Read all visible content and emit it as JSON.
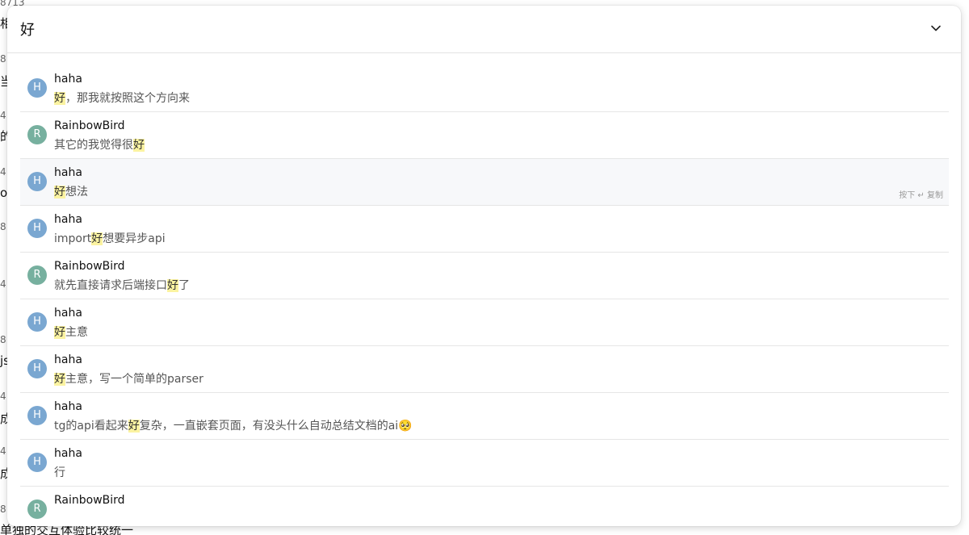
{
  "background": {
    "lines": [
      {
        "kind": "meta",
        "text": "8713"
      },
      {
        "kind": "text",
        "text": "相"
      },
      {
        "kind": "meta",
        "text": "8"
      },
      {
        "kind": "text",
        "text": "当"
      },
      {
        "kind": "meta",
        "text": "4"
      },
      {
        "kind": "text",
        "text": "的"
      },
      {
        "kind": "meta",
        "text": "4"
      },
      {
        "kind": "text",
        "text": "or"
      },
      {
        "kind": "meta",
        "text": "8"
      },
      {
        "kind": "meta",
        "text": "4"
      },
      {
        "kind": "meta",
        "text": "8"
      },
      {
        "kind": "text",
        "text": "js"
      },
      {
        "kind": "meta",
        "text": "4"
      },
      {
        "kind": "text",
        "text": "成"
      },
      {
        "kind": "meta",
        "text": "4"
      },
      {
        "kind": "text",
        "text": "成"
      },
      {
        "kind": "meta",
        "text": "8"
      },
      {
        "kind": "text",
        "text": "单独的交互体验比较统一"
      }
    ]
  },
  "search": {
    "query": "好",
    "collapse_icon": "chevron-down-icon"
  },
  "results": [
    {
      "avatar": "H",
      "avatar_color": "#7aa7d1",
      "sender": "haha",
      "before": "",
      "match": "好",
      "after": "，那我就按照这个方向来",
      "selected": false
    },
    {
      "avatar": "R",
      "avatar_color": "#77b09f",
      "sender": "RainbowBird",
      "before": "其它的我觉得很",
      "match": "好",
      "after": "",
      "selected": false
    },
    {
      "avatar": "H",
      "avatar_color": "#7aa7d1",
      "sender": "haha",
      "before": "",
      "match": "好",
      "after": "想法",
      "selected": true,
      "hint": "按下 ↵ 复制"
    },
    {
      "avatar": "H",
      "avatar_color": "#7aa7d1",
      "sender": "haha",
      "before": "import",
      "match": "好",
      "after": "想要异步api",
      "selected": false
    },
    {
      "avatar": "R",
      "avatar_color": "#77b09f",
      "sender": "RainbowBird",
      "before": "就先直接请求后端接口",
      "match": "好",
      "after": "了",
      "selected": false
    },
    {
      "avatar": "H",
      "avatar_color": "#7aa7d1",
      "sender": "haha",
      "before": "",
      "match": "好",
      "after": "主意",
      "selected": false
    },
    {
      "avatar": "H",
      "avatar_color": "#7aa7d1",
      "sender": "haha",
      "before": "",
      "match": "好",
      "after": "主意，写一个简单的parser",
      "selected": false
    },
    {
      "avatar": "H",
      "avatar_color": "#7aa7d1",
      "sender": "haha",
      "before": "tg的api看起来",
      "match": "好",
      "after": "复杂，一直嵌套页面，有没头什么自动总结文档的ai🥺",
      "selected": false
    },
    {
      "avatar": "H",
      "avatar_color": "#7aa7d1",
      "sender": "haha",
      "before": "行",
      "match": "",
      "after": "",
      "selected": false
    },
    {
      "avatar": "R",
      "avatar_color": "#77b09f",
      "sender": "RainbowBird",
      "before": "",
      "match": "",
      "after": "",
      "selected": false
    }
  ]
}
